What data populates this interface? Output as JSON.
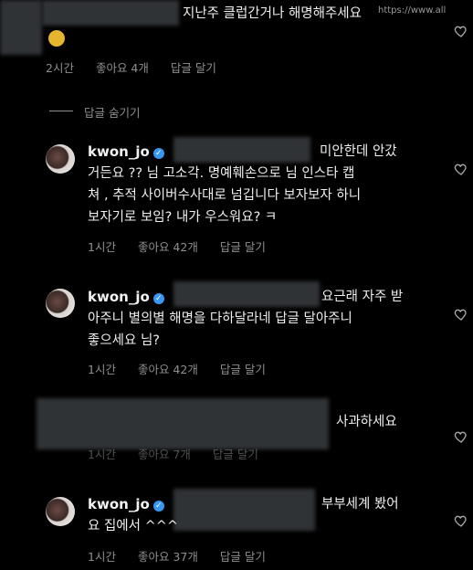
{
  "top_comment": {
    "text": "지난주 클럽간거나 해명해주세요",
    "watermark": "https://www.all",
    "time": "2시간",
    "likes": "좋아요 4개",
    "reply": "답글 달기"
  },
  "hide_replies": "답글 숨기기",
  "replies": [
    {
      "username": "kwon_jo",
      "line1_suffix": "미안한데 안갔",
      "lines": [
        "거든요 ?? 님 고소각. 명예훼손으로 님 인스타 캡",
        "쳐 , 추적 사이버수사대로 넘깁니다 보자보자 하니",
        "보자기로 보임? 내가 우스워요? ㅋ"
      ],
      "time": "1시간",
      "likes": "좋아요 42개",
      "reply": "답글 달기"
    },
    {
      "username": "kwon_jo",
      "line1_suffix": "요근래 자주 받",
      "lines": [
        "아주니  별의별 해명을 다하달라네 답글 달아주니",
        "좋으세요 님?"
      ],
      "time": "1시간",
      "likes": "좋아요 42개",
      "reply": "답글 달기"
    },
    {
      "username": "",
      "line1_suffix": "사과하세요",
      "lines": [],
      "time": "1시간",
      "likes": "좋아요 7개",
      "reply": "답글 달기"
    },
    {
      "username": "kwon_jo",
      "line1_suffix": "부부세계 봤어",
      "lines": [
        "요 집에서 ^^^"
      ],
      "time": "1시간",
      "likes": "좋아요 37개",
      "reply": "답글 달기"
    }
  ],
  "icons": {
    "heart": "heart-outline-icon",
    "verified": "verified-badge-icon",
    "emoji": "emoji-icon"
  },
  "colors": {
    "background": "#000000",
    "text": "#efefef",
    "muted": "#8e8e8e",
    "verified": "#3897f0",
    "redaction": "#303336"
  }
}
